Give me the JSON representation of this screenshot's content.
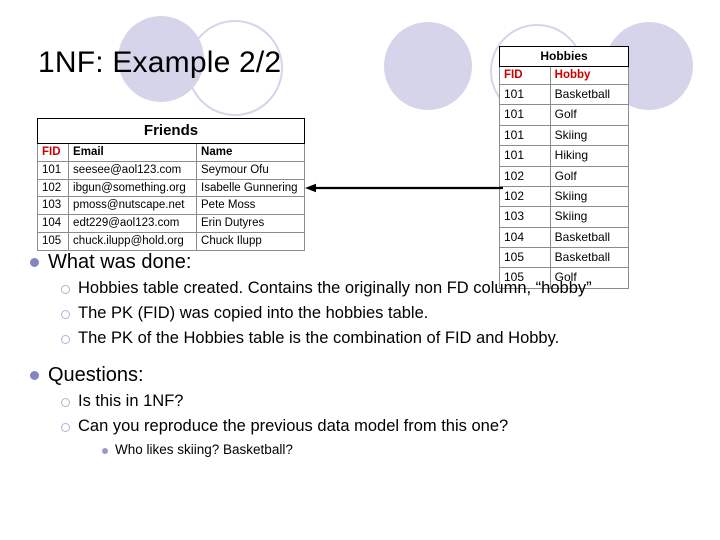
{
  "slide": {
    "title": "1NF: Example 2/2",
    "accent_lavender": "#d5d4ea",
    "accent_red": "#cc0000",
    "bullet_color": "#8583c4"
  },
  "friends_table": {
    "name": "Friends",
    "columns": [
      "FID",
      "Email",
      "Name"
    ],
    "rows": [
      [
        "101",
        "seesee@aol123.com",
        "Seymour Ofu"
      ],
      [
        "102",
        "ibgun@something.org",
        "Isabelle Gunnering"
      ],
      [
        "103",
        "pmoss@nutscape.net",
        "Pete Moss"
      ],
      [
        "104",
        "edt229@aol123.com",
        "Erin Dutyres"
      ],
      [
        "105",
        "chuck.ilupp@hold.org",
        "Chuck Ilupp"
      ]
    ]
  },
  "hobbies_table": {
    "name": "Hobbies",
    "columns": [
      "FID",
      "Hobby"
    ],
    "rows": [
      [
        "101",
        "Basketball"
      ],
      [
        "101",
        "Golf"
      ],
      [
        "101",
        "Skiing"
      ],
      [
        "101",
        "Hiking"
      ],
      [
        "102",
        "Golf"
      ],
      [
        "102",
        "Skiing"
      ],
      [
        "103",
        "Skiing"
      ],
      [
        "104",
        "Basketball"
      ],
      [
        "105",
        "Basketball"
      ],
      [
        "105",
        "Golf"
      ]
    ]
  },
  "arrow": {
    "label": "relationship-arrow-hobbies-to-friends",
    "direction": "left"
  },
  "content": {
    "section1_heading": "What was done:",
    "section1_items": [
      "Hobbies table created. Contains the originally non FD column, “hobby”",
      "The PK (FID) was copied into the hobbies table.",
      "The PK of the Hobbies table is the combination of FID and Hobby."
    ],
    "section2_heading": "Questions:",
    "section2_items": [
      "Is this in 1NF?",
      "Can you reproduce the previous data model from this one?"
    ],
    "section2_subitems": [
      "Who likes skiing? Basketball?"
    ]
  }
}
